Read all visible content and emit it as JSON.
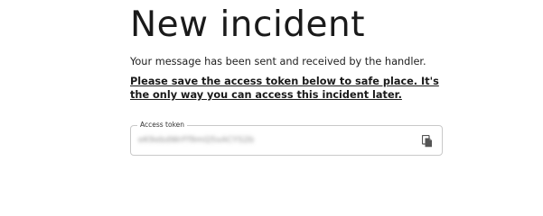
{
  "page": {
    "title": "New incident",
    "message": "Your message has been sent and received by the handler.",
    "warning": "Please save the access token below to safe place. It's the only way you can access this incident later."
  },
  "token": {
    "label": "Access token",
    "value": "eK9ebdWrFf9mQ5xACYS2b"
  },
  "icons": {
    "copy": "copy-icon"
  },
  "colors": {
    "text": "#1a1a1a",
    "field_border": "#c9c9c9",
    "icon": "#555555"
  }
}
